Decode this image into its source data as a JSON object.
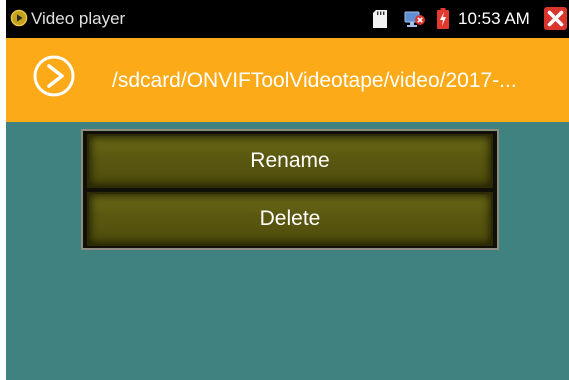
{
  "status_bar": {
    "app_title": "Video player",
    "time": "10:53 AM",
    "icons": [
      "play-circle-icon",
      "sd-card-icon",
      "network-disconnected-icon",
      "battery-charging-icon",
      "close-icon"
    ]
  },
  "path_bar": {
    "path": "/sdcard/ONVIFToolVideotape/video/2017-...",
    "icon": "play-circle-icon"
  },
  "menu": {
    "items": [
      {
        "label": "Rename"
      },
      {
        "label": "Delete"
      }
    ]
  },
  "colors": {
    "background": "#3f8280",
    "status_bar": "#000000",
    "path_bar": "#fdaa18",
    "menu_item": "#5a5810",
    "close": "#d9352d"
  }
}
